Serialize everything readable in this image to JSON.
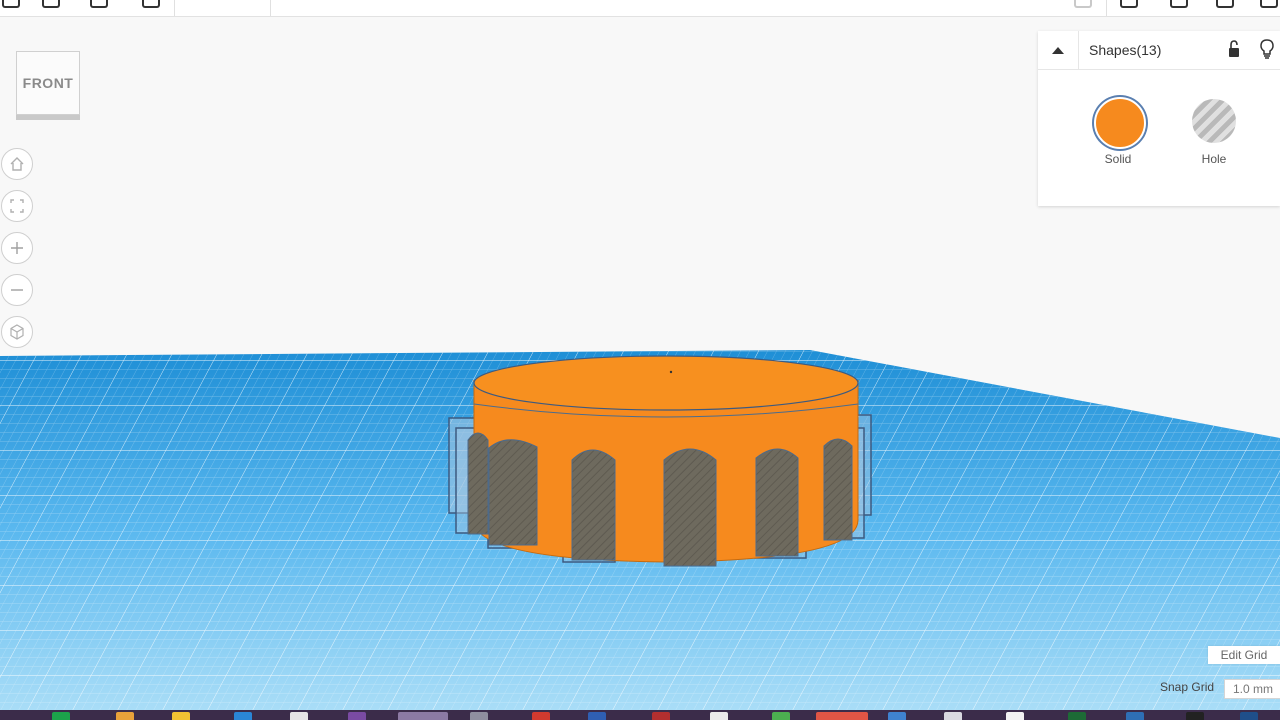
{
  "viewcube": {
    "label": "FRONT"
  },
  "nav_controls": [
    "home-icon",
    "fit-view-icon",
    "zoom-in-icon",
    "zoom-out-icon",
    "perspective-icon"
  ],
  "inspector": {
    "title": "Shapes(13)",
    "solid": {
      "label": "Solid",
      "color": "#f68a1e"
    },
    "hole": {
      "label": "Hole"
    }
  },
  "grid": {
    "edit_label": "Edit Grid",
    "snap_label": "Snap Grid",
    "snap_value": "1.0 mm"
  },
  "colors": {
    "workplane": "#2f9fe6",
    "workplane_line": "#ffffff",
    "shape_solid": "#f68a1e",
    "shape_hole": "#6e6a5e",
    "selection": "#3d5a80"
  }
}
